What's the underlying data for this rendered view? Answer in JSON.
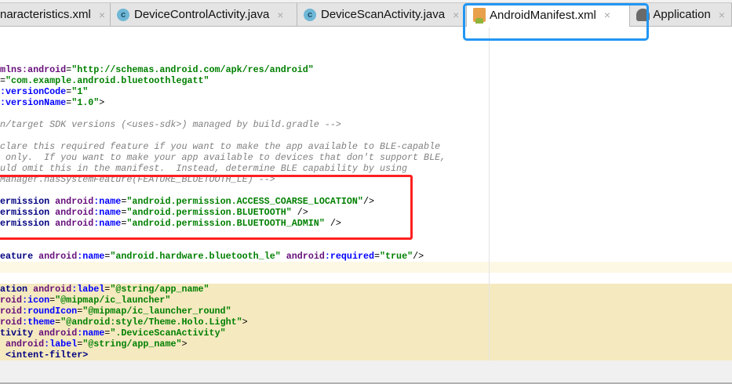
{
  "tabs": [
    {
      "label": "naracteristics.xml",
      "icon": "xml-file-icon",
      "active": false
    },
    {
      "label": "DeviceControlActivity.java",
      "icon": "class-c-icon",
      "active": false
    },
    {
      "label": "DeviceScanActivity.java",
      "icon": "class-c-icon",
      "active": false
    },
    {
      "label": "AndroidManifest.xml",
      "icon": "android-manifest-icon",
      "active": true
    },
    {
      "label": "Application",
      "icon": "android-app-icon",
      "active": false
    }
  ],
  "close_glyph": "×",
  "class_glyph": "c",
  "colors": {
    "highlight_red": "#ff2020",
    "highlight_blue": "#2196f3",
    "tag": "#000080",
    "namespace": "#660e7a",
    "attribute": "#0000ff",
    "value": "#008000",
    "comment": "#808080",
    "line_highlight": "#f5e9bf"
  },
  "code": [
    [
      [
        "ns",
        "mlns:android"
      ],
      [
        "pun",
        "="
      ],
      [
        "val",
        "\"http://schemas.android.com/apk/res/android\""
      ]
    ],
    [
      [
        "pun",
        "="
      ],
      [
        "val",
        "\"com.example.android.bluetoothlegatt\""
      ]
    ],
    [
      [
        "attr",
        ":versionCode"
      ],
      [
        "pun",
        "="
      ],
      [
        "val",
        "\"1\""
      ]
    ],
    [
      [
        "attr",
        ":versionName"
      ],
      [
        "pun",
        "="
      ],
      [
        "val",
        "\"1.0\""
      ],
      [
        "pun",
        ">"
      ]
    ],
    [],
    [
      [
        "cmt",
        "n/target SDK versions (<uses-sdk>) managed by build.gradle -->"
      ]
    ],
    [],
    [
      [
        "cmt",
        "clare this required feature if you want to make the app available to BLE-capable"
      ]
    ],
    [
      [
        "cmt",
        " only.  If you want to make your app available to devices that don't support BLE,"
      ]
    ],
    [
      [
        "cmt",
        "uld omit this in the manifest.  Instead, determine BLE capability by using"
      ]
    ],
    [
      [
        "cmt",
        "Manager.hasSystemFeature(FEATURE_BLUETOOTH_LE) -->"
      ]
    ],
    [],
    [
      [
        "tag",
        "ermission "
      ],
      [
        "ns",
        "android"
      ],
      [
        "attr",
        ":name"
      ],
      [
        "pun",
        "="
      ],
      [
        "val",
        "\"android.permission.ACCESS_COARSE_LOCATION\""
      ],
      [
        "pun",
        "/>"
      ]
    ],
    [
      [
        "tag",
        "ermission "
      ],
      [
        "ns",
        "android"
      ],
      [
        "attr",
        ":name"
      ],
      [
        "pun",
        "="
      ],
      [
        "val",
        "\"android.permission.BLUETOOTH\""
      ],
      [
        "pun",
        " />"
      ]
    ],
    [
      [
        "tag",
        "ermission "
      ],
      [
        "ns",
        "android"
      ],
      [
        "attr",
        ":name"
      ],
      [
        "pun",
        "="
      ],
      [
        "val",
        "\"android.permission.BLUETOOTH_ADMIN\""
      ],
      [
        "pun",
        " />"
      ]
    ],
    [],
    [],
    [
      [
        "tag",
        "eature "
      ],
      [
        "ns",
        "android"
      ],
      [
        "attr",
        ":name"
      ],
      [
        "pun",
        "="
      ],
      [
        "val",
        "\"android.hardware.bluetooth_le\""
      ],
      [
        "pun",
        " "
      ],
      [
        "ns",
        "android"
      ],
      [
        "attr",
        ":required"
      ],
      [
        "pun",
        "="
      ],
      [
        "val",
        "\"true\""
      ],
      [
        "pun",
        "/>"
      ]
    ],
    [],
    [],
    [
      [
        "tag",
        "ation "
      ],
      [
        "ns",
        "android"
      ],
      [
        "attr",
        ":label"
      ],
      [
        "pun",
        "="
      ],
      [
        "val",
        "\"@string/app_name\""
      ]
    ],
    [
      [
        "ns",
        "roid"
      ],
      [
        "attr",
        ":icon"
      ],
      [
        "pun",
        "="
      ],
      [
        "val",
        "\"@mipmap/ic_launcher\""
      ]
    ],
    [
      [
        "ns",
        "roid"
      ],
      [
        "attr",
        ":roundIcon"
      ],
      [
        "pun",
        "="
      ],
      [
        "val",
        "\"@mipmap/ic_launcher_round\""
      ]
    ],
    [
      [
        "ns",
        "roid"
      ],
      [
        "attr",
        ":theme"
      ],
      [
        "pun",
        "="
      ],
      [
        "val",
        "\"@android:style/Theme.Holo.Light\""
      ],
      [
        "pun",
        ">"
      ]
    ],
    [
      [
        "tag",
        "tivity "
      ],
      [
        "ns",
        "android"
      ],
      [
        "attr",
        ":name"
      ],
      [
        "pun",
        "="
      ],
      [
        "val",
        "\".DeviceScanActivity\""
      ]
    ],
    [
      [
        "pun",
        " "
      ],
      [
        "ns",
        "android"
      ],
      [
        "attr",
        ":label"
      ],
      [
        "pun",
        "="
      ],
      [
        "val",
        "\"@string/app_name\""
      ],
      [
        "pun",
        ">"
      ]
    ],
    [
      [
        "pun",
        " "
      ],
      [
        "tag",
        "<intent-filter>"
      ]
    ]
  ],
  "line_highlight": {
    "strong": [
      20,
      21,
      22,
      23,
      24,
      25,
      26
    ],
    "soft": [
      18
    ]
  }
}
